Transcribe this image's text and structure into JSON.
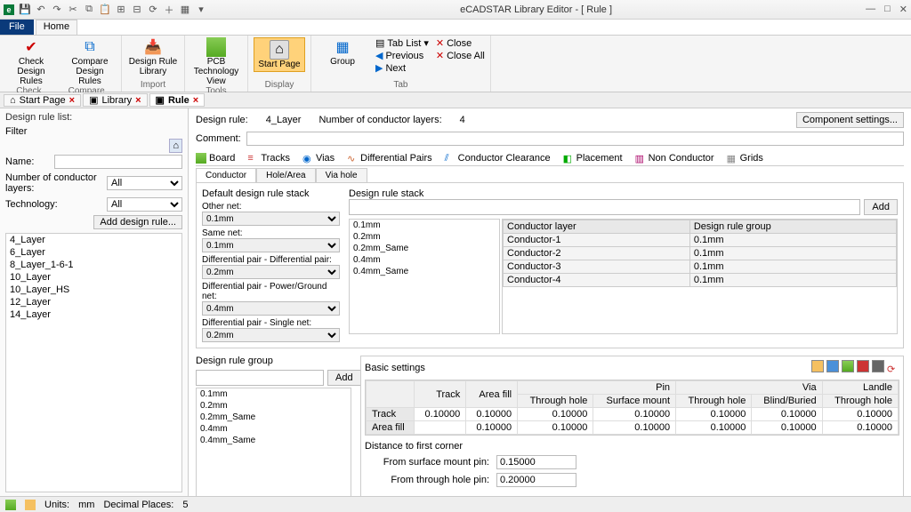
{
  "app": {
    "title": "eCADSTAR Library Editor - [ Rule ]"
  },
  "menu": {
    "file": "File",
    "home": "Home"
  },
  "ribbon": {
    "check": {
      "btn1": "Check Design Rules",
      "btn2": "Compare Design Rules",
      "label": "Check",
      "label2": "Compare"
    },
    "import": {
      "btn": "Design Rule Library",
      "label": "Import"
    },
    "tools": {
      "btn": "PCB Technology View",
      "label": "Tools"
    },
    "display": {
      "btn": "Start Page",
      "label": "Display"
    },
    "tab": {
      "group": "Group",
      "tablist": "Tab List",
      "prev": "Previous",
      "next": "Next",
      "close": "Close",
      "closeall": "Close All",
      "label": "Tab"
    }
  },
  "doctabs": {
    "start": "Start Page",
    "library": "Library",
    "rule": "Rule"
  },
  "left": {
    "title": "Design rule list:",
    "filter": "Filter",
    "name": "Name:",
    "nlayers": "Number of conductor layers:",
    "nlayers_val": "All",
    "tech": "Technology:",
    "tech_val": "All",
    "add": "Add design rule...",
    "rules": [
      "4_Layer",
      "6_Layer",
      "8_Layer_1-6-1",
      "10_Layer",
      "10_Layer_HS",
      "12_Layer",
      "14_Layer"
    ]
  },
  "right": {
    "drlabel": "Design rule:",
    "drval": "4_Layer",
    "nclabel": "Number of conductor layers:",
    "ncval": "4",
    "compset": "Component settings...",
    "comment": "Comment:",
    "cats": [
      "Board",
      "Tracks",
      "Vias",
      "Differential Pairs",
      "Conductor Clearance",
      "Placement",
      "Non Conductor",
      "Grids"
    ],
    "subtabs": [
      "Conductor",
      "Hole/Area",
      "Via hole"
    ],
    "defstack": {
      "title": "Default design rule stack",
      "other": "Other net:",
      "other_v": "0.1mm",
      "same": "Same net:",
      "same_v": "0.1mm",
      "dpdp": "Differential pair - Differential pair:",
      "dpdp_v": "0.2mm",
      "dppg": "Differential pair - Power/Ground net:",
      "dppg_v": "0.4mm",
      "dpsn": "Differential pair - Single net:",
      "dpsn_v": "0.2mm"
    },
    "rstack": {
      "title": "Design rule stack",
      "add": "Add",
      "list": [
        "0.1mm",
        "0.2mm",
        "0.2mm_Same",
        "0.4mm",
        "0.4mm_Same"
      ],
      "colh1": "Conductor layer",
      "colh2": "Design rule group",
      "rows": [
        {
          "l": "Conductor-1",
          "g": "0.1mm"
        },
        {
          "l": "Conductor-2",
          "g": "0.1mm"
        },
        {
          "l": "Conductor-3",
          "g": "0.1mm"
        },
        {
          "l": "Conductor-4",
          "g": "0.1mm"
        }
      ]
    },
    "rgroup": {
      "title": "Design rule group",
      "add": "Add",
      "list": [
        "0.1mm",
        "0.2mm",
        "0.2mm_Same",
        "0.4mm",
        "0.4mm_Same"
      ],
      "basic": "Basic settings",
      "cols": {
        "track": "Track",
        "areafill": "Area fill",
        "pin": "Pin",
        "via": "Via",
        "landle": "Landle",
        "th": "Through hole",
        "sm": "Surface mount",
        "bb": "Blind/Buried"
      },
      "rows": {
        "track": {
          "name": "Track",
          "track": "0.10000",
          "areafill": "0.10000",
          "pth": "0.10000",
          "psm": "0.10000",
          "vth": "0.10000",
          "vbb": "0.10000",
          "lth": "0.10000"
        },
        "areafill": {
          "name": "Area fill",
          "track": "",
          "areafill": "0.10000",
          "pth": "0.10000",
          "psm": "0.10000",
          "vth": "0.10000",
          "vbb": "0.10000",
          "lth": "0.10000"
        }
      },
      "dist_title": "Distance to first corner",
      "dist_sm": "From surface mount pin:",
      "dist_sm_v": "0.15000",
      "dist_th": "From through hole pin:",
      "dist_th_v": "0.20000"
    }
  },
  "status": {
    "units_l": "Units:",
    "units_v": "mm",
    "dp_l": "Decimal Places:",
    "dp_v": "5"
  }
}
